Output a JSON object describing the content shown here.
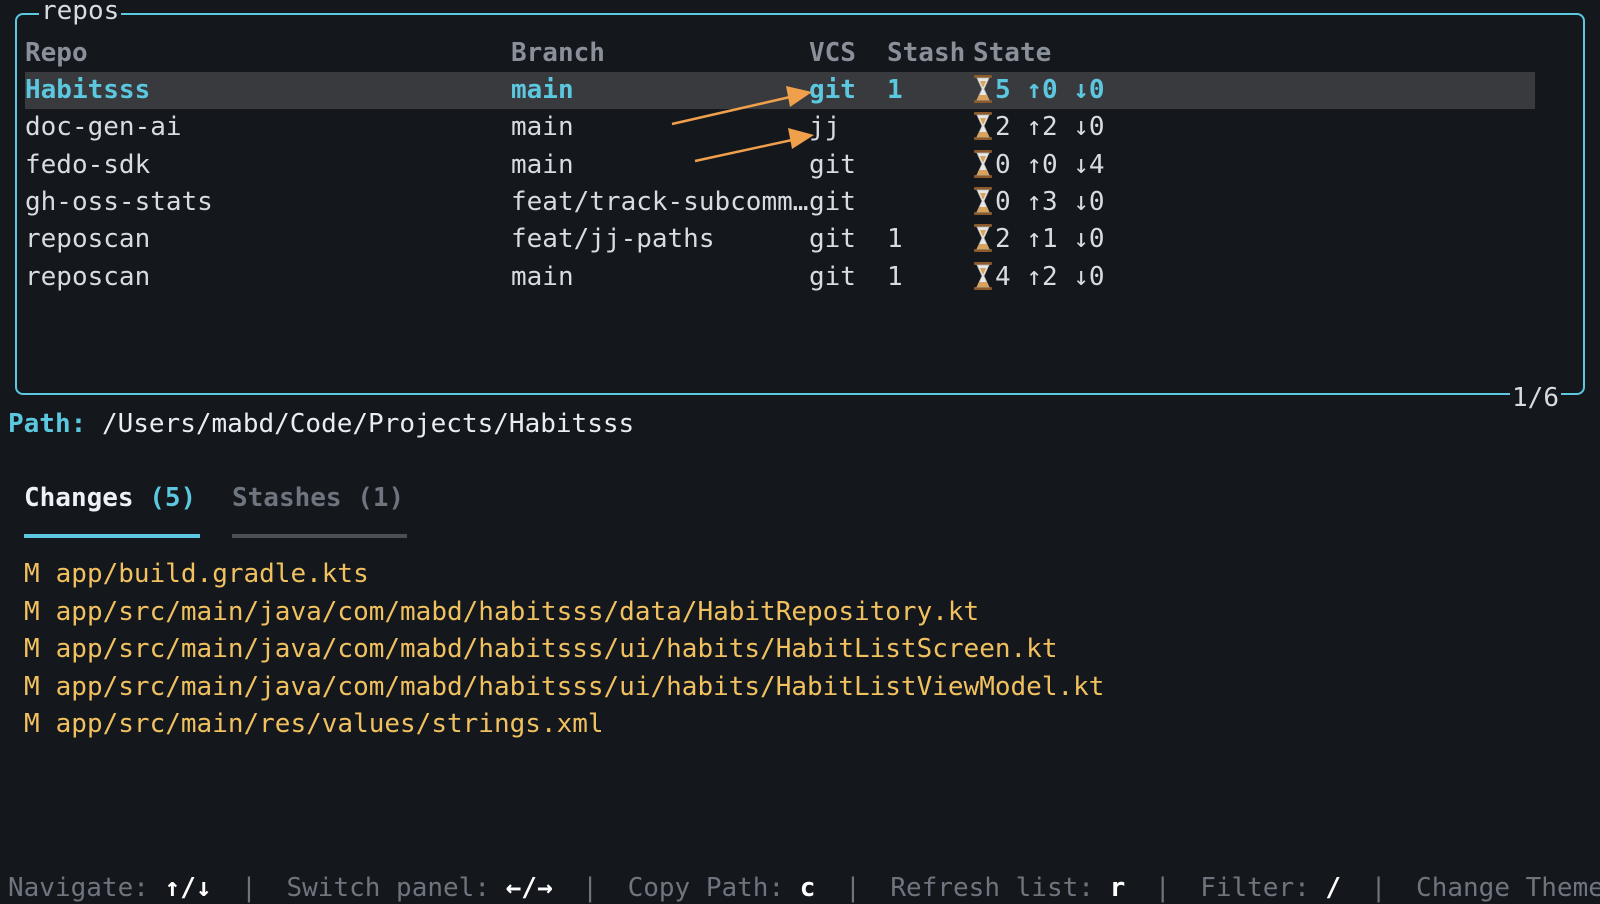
{
  "panel": {
    "title": "repos",
    "counter": "1/6"
  },
  "table": {
    "headers": {
      "repo": "Repo",
      "branch": "Branch",
      "vcs": "VCS",
      "stash": "Stash",
      "state": "State"
    },
    "rows": [
      {
        "repo": "Habitsss",
        "branch": "main",
        "vcs": "git",
        "stash": "1",
        "state": "5 ↑0 ↓0",
        "selected": true
      },
      {
        "repo": "doc-gen-ai",
        "branch": "main",
        "vcs": "jj",
        "stash": "",
        "state": "2 ↑2 ↓0"
      },
      {
        "repo": "fedo-sdk",
        "branch": "main",
        "vcs": "git",
        "stash": "",
        "state": "0 ↑0 ↓4"
      },
      {
        "repo": "gh-oss-stats",
        "branch": "feat/track-subcomm…",
        "vcs": "git",
        "stash": "",
        "state": "0 ↑3 ↓0"
      },
      {
        "repo": "reposcan",
        "branch": "feat/jj-paths",
        "vcs": "git",
        "stash": "1",
        "state": "2 ↑1 ↓0"
      },
      {
        "repo": "reposcan",
        "branch": "main",
        "vcs": "git",
        "stash": "1",
        "state": "4 ↑2 ↓0"
      }
    ]
  },
  "path": {
    "label": "Path:",
    "value": "/Users/mabd/Code/Projects/Habitsss"
  },
  "tabs": [
    {
      "label": "Changes",
      "count": "(5)",
      "active": true
    },
    {
      "label": "Stashes",
      "count": "(1)",
      "active": false
    }
  ],
  "changes": [
    {
      "status": "M",
      "file": "app/build.gradle.kts"
    },
    {
      "status": "M",
      "file": "app/src/main/java/com/mabd/habitsss/data/HabitRepository.kt"
    },
    {
      "status": "M",
      "file": "app/src/main/java/com/mabd/habitsss/ui/habits/HabitListScreen.kt"
    },
    {
      "status": "M",
      "file": "app/src/main/java/com/mabd/habitsss/ui/habits/HabitListViewModel.kt"
    },
    {
      "status": "M",
      "file": "app/src/main/res/values/strings.xml"
    }
  ],
  "footer": {
    "navigate_label": "Navigate:",
    "navigate_key": "↑/↓",
    "switch_label": "Switch panel:",
    "switch_key": "←/→",
    "copy_label": "Copy Path:",
    "copy_key": "c",
    "refresh_label": "Refresh list:",
    "refresh_key": "r",
    "filter_label": "Filter:",
    "filter_key": "/",
    "theme_label": "Change Theme:",
    "separator": "|"
  },
  "icons": {
    "state_icon": "hourglass-icon"
  },
  "colors": {
    "accent": "#5cc8e0",
    "background": "#14171c",
    "selected_row": "#383a3e",
    "modified_file": "#f1c15f",
    "annotation_arrow": "#f0a04b"
  }
}
